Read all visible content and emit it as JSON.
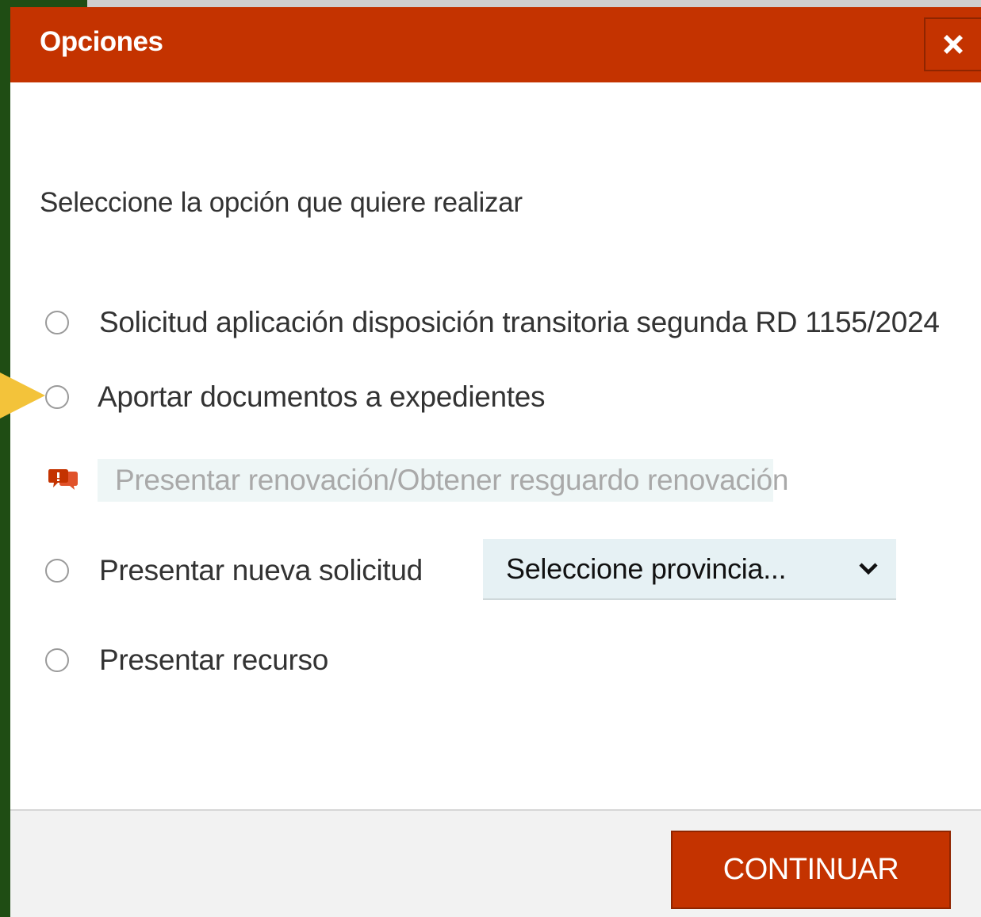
{
  "dialog": {
    "title": "Opciones",
    "close_icon": "close-icon",
    "prompt": "Seleccione la opción que quiere realizar",
    "options": [
      {
        "label": "Solicitud aplicación disposición transitoria segunda RD 1155/2024",
        "selected": false
      },
      {
        "label": "Aportar documentos a expedientes",
        "selected": false
      },
      {
        "label": "Presentar nueva solicitud",
        "selected": false
      },
      {
        "label": "Presentar recurso",
        "selected": false
      }
    ],
    "disabled_option": {
      "label": "Presentar renovación/Obtener resguardo renovación",
      "icon": "chat-bubbles-icon"
    },
    "province_select": {
      "value": "Seleccione provincia..."
    },
    "continue_label": "CONTINUAR"
  },
  "colors": {
    "header": "#c43300",
    "button": "#c43300",
    "side_strip": "#1f4d14",
    "arrow": "#f3c33a",
    "select_bg": "#e6f1f4"
  }
}
